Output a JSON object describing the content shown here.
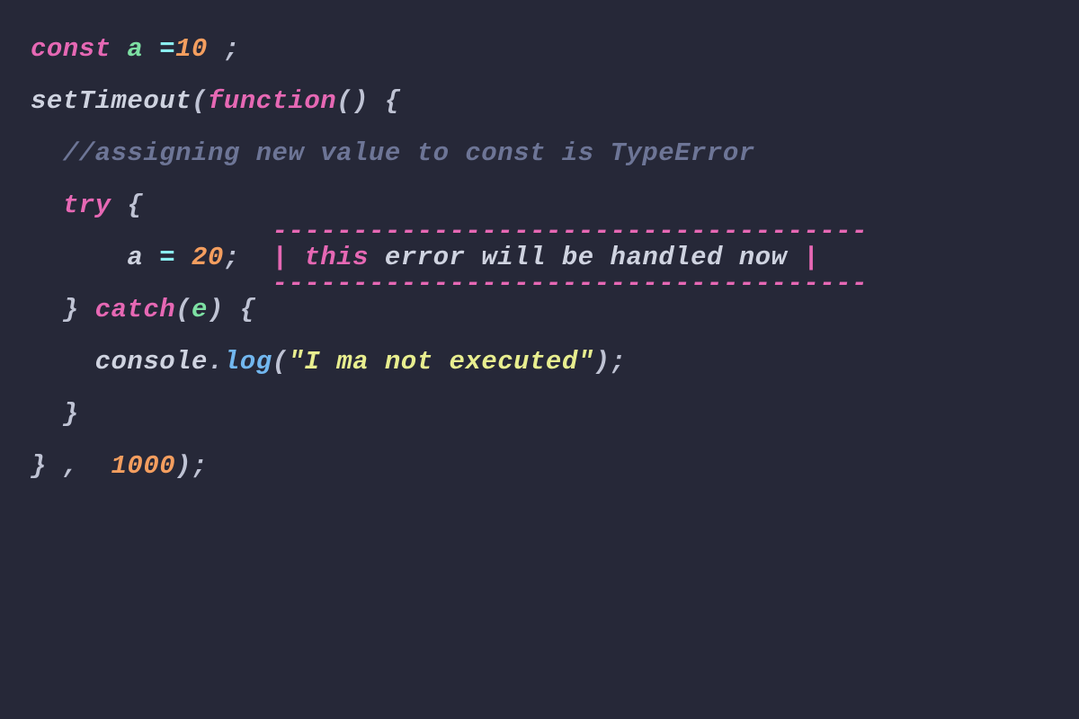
{
  "code": {
    "l1": {
      "const": "const",
      "var": "a",
      "eq": "=",
      "val": "10",
      "semi": ";"
    },
    "l3": {
      "fn": "setTimeout",
      "open": "(",
      "func": "function",
      "parens": "()",
      "brace": "{"
    },
    "l5": {
      "comment": "//assigning new value to const is TypeError"
    },
    "l7": {
      "try": "try",
      "brace": "{"
    },
    "annot": {
      "dashes_top": "-------------------------------------",
      "pipe1": "|",
      "word_this": "this",
      "rest": "error will be handled now",
      "pipe2": "|",
      "dashes_bot": "-------------------------------------"
    },
    "l9": {
      "var": "a",
      "eq": "=",
      "val": "20",
      "semi": ";"
    },
    "l11": {
      "close": "}",
      "catch": "catch",
      "open": "(",
      "param": "e",
      "closep": ")",
      "brace": "{"
    },
    "l13": {
      "obj": "console",
      "dot": ".",
      "method": "log",
      "open": "(",
      "str": "\"I ma not executed\"",
      "closep": ")",
      "semi": ";"
    },
    "l15": {
      "close": "}"
    },
    "l17": {
      "close": "}",
      "comma": ",",
      "val": "1000",
      "closep": ")",
      "semi": ";"
    }
  }
}
